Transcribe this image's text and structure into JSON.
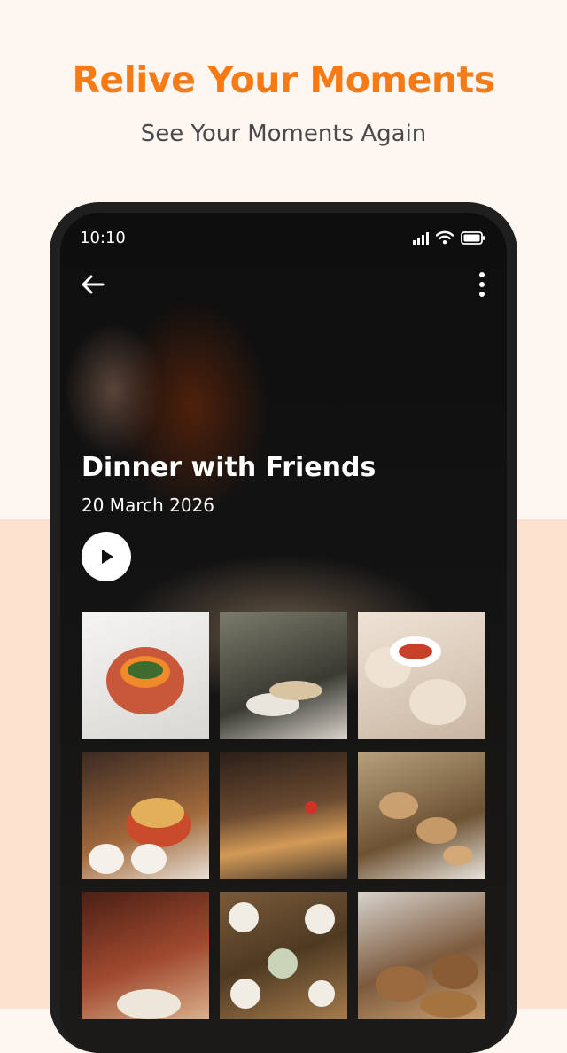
{
  "header": {
    "headline": "Relive Your Moments",
    "subheadline": "See Your Moments Again"
  },
  "colors": {
    "accent": "#f47b16",
    "subtitle": "#4a4a4a",
    "top_background": "#fdf6f1",
    "bottom_background": "#fde3cf"
  },
  "status_bar": {
    "time": "10:10",
    "icons": [
      "signal-icon",
      "wifi-icon",
      "battery-icon"
    ]
  },
  "album": {
    "title": "Dinner with Friends",
    "date": "20 March 2026"
  },
  "icons": {
    "back": "back-arrow-icon",
    "more": "more-vertical-icon",
    "play": "play-icon"
  },
  "photos": [
    "photo-1",
    "photo-2",
    "photo-3",
    "photo-4",
    "photo-5",
    "photo-6",
    "photo-7",
    "photo-8",
    "photo-9"
  ]
}
